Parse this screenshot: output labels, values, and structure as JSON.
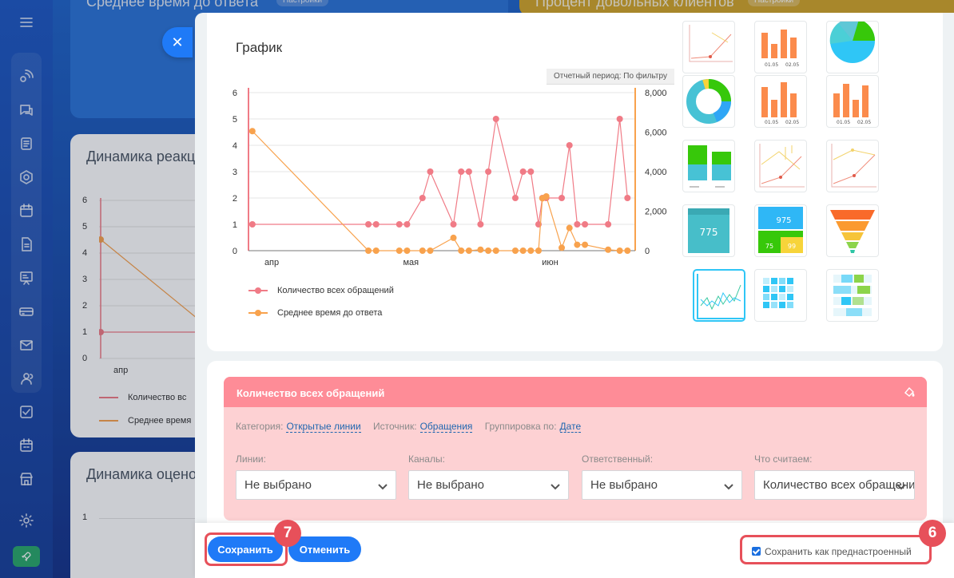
{
  "background": {
    "card_top_left_title": "Среднее время до ответа",
    "card_top_left_badge": "Настройки",
    "card_top_right_title": "Процент довольных клиентов",
    "card_top_right_badge": "Настройки",
    "card_mid_title": "Динамика реакции",
    "card_mid_ticks": [
      "6",
      "5",
      "4",
      "3",
      "2",
      "1",
      "0"
    ],
    "card_mid_xlabel": "апр",
    "card_mid_legend": [
      "Количество вс",
      "Среднее время"
    ],
    "card_bottom_title": "Динамика оценок",
    "card_bottom_tick": "1"
  },
  "chart_panel": {
    "title": "График",
    "period_label": "Отчетный период: По фильтру"
  },
  "chart_data": {
    "type": "line",
    "title": "График",
    "x": [
      "апр",
      "мая",
      "июн"
    ],
    "y_left_ticks": [
      "0",
      "1",
      "2",
      "3",
      "4",
      "5",
      "6"
    ],
    "y_right_ticks": [
      "0",
      "2,000",
      "4,000",
      "6,000",
      "8,000"
    ],
    "ylim_left": [
      0,
      6
    ],
    "ylim_right": [
      0,
      8000
    ],
    "grid": true,
    "legend_position": "bottom-left",
    "series": [
      {
        "name": "Количество всех обращений",
        "color": "#f07b86",
        "axis": "left",
        "points": [
          [
            0.01,
            1
          ],
          [
            0.31,
            1
          ],
          [
            0.33,
            1
          ],
          [
            0.39,
            1
          ],
          [
            0.41,
            1
          ],
          [
            0.45,
            2
          ],
          [
            0.47,
            3
          ],
          [
            0.53,
            1
          ],
          [
            0.55,
            3
          ],
          [
            0.57,
            3
          ],
          [
            0.6,
            1
          ],
          [
            0.62,
            3
          ],
          [
            0.64,
            5
          ],
          [
            0.69,
            2
          ],
          [
            0.71,
            3
          ],
          [
            0.73,
            3
          ],
          [
            0.75,
            1
          ],
          [
            0.76,
            2
          ],
          [
            0.77,
            2
          ],
          [
            0.81,
            2
          ],
          [
            0.83,
            4
          ],
          [
            0.85,
            1
          ],
          [
            0.87,
            1
          ],
          [
            0.93,
            1
          ],
          [
            0.96,
            5
          ],
          [
            0.98,
            2
          ]
        ]
      },
      {
        "name": "Среднее время до ответа",
        "color": "#f8a24d",
        "axis": "right",
        "points": [
          [
            0.01,
            6050
          ],
          [
            0.31,
            0
          ],
          [
            0.33,
            0
          ],
          [
            0.39,
            0
          ],
          [
            0.41,
            0
          ],
          [
            0.45,
            0
          ],
          [
            0.47,
            0
          ],
          [
            0.53,
            650
          ],
          [
            0.55,
            0
          ],
          [
            0.57,
            0
          ],
          [
            0.6,
            50
          ],
          [
            0.62,
            0
          ],
          [
            0.64,
            0
          ],
          [
            0.69,
            0
          ],
          [
            0.71,
            0
          ],
          [
            0.73,
            0
          ],
          [
            0.75,
            0
          ],
          [
            0.76,
            2650
          ],
          [
            0.77,
            2750
          ],
          [
            0.81,
            150
          ],
          [
            0.83,
            1150
          ],
          [
            0.85,
            300
          ],
          [
            0.87,
            300
          ],
          [
            0.93,
            50
          ],
          [
            0.96,
            0
          ],
          [
            0.98,
            0
          ]
        ]
      }
    ]
  },
  "chart_types": [
    "line-mixed",
    "bar-dates",
    "pie",
    "donut",
    "bar-dates-2",
    "bar-dates-3",
    "stacked-bar",
    "line-multi",
    "line-multi-2",
    "number-widget",
    "multi-number-widget",
    "funnel",
    "line-active",
    "heatmap",
    "colored-rows"
  ],
  "number_widget": {
    "value": "775"
  },
  "multi_number_widget": {
    "values": [
      "975",
      "75",
      "99"
    ]
  },
  "bar_date_labels": [
    "01.05",
    "02.05"
  ],
  "series_config": {
    "title": "Количество всех обращений",
    "category_label": "Категория:",
    "category_value": "Открытые линии",
    "source_label": "Источник:",
    "source_value": "Обращения",
    "group_label": "Группировка по:",
    "group_value": "Дате",
    "selects": [
      {
        "label": "Линии:",
        "value": "Не выбрано"
      },
      {
        "label": "Каналы:",
        "value": "Не выбрано"
      },
      {
        "label": "Ответственный:",
        "value": "Не выбрано"
      },
      {
        "label": "Что считаем:",
        "value": "Количество всех обращений"
      }
    ]
  },
  "footer": {
    "save_label": "Сохранить",
    "cancel_label": "Отменить",
    "preset_label": "Сохранить как преднастроенный",
    "step_save": "7",
    "step_preset": "6"
  },
  "colors": {
    "accent": "#1f7af7",
    "series_red": "#f07b86",
    "series_orange": "#f8a24d",
    "highlight": "#e7505a"
  }
}
